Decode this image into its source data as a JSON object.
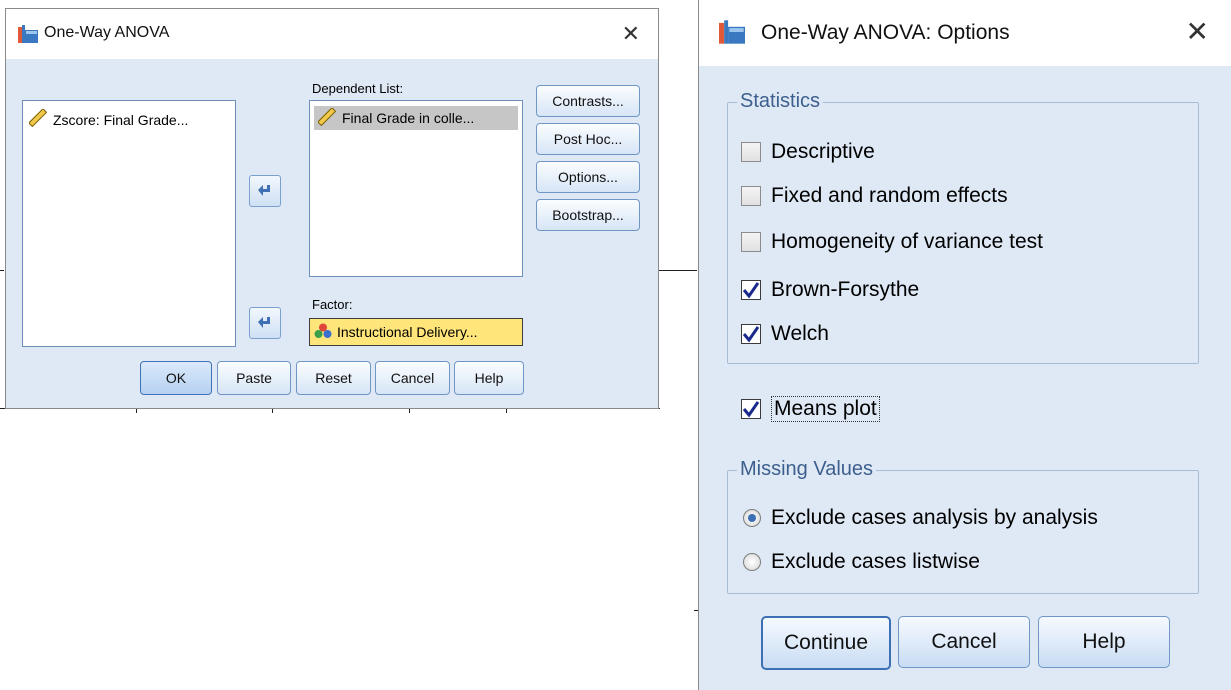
{
  "anova_dialog": {
    "title": "One-Way ANOVA",
    "variables": [
      {
        "label": "Zscore:  Final Grade...",
        "icon": "scale-ruler-icon"
      }
    ],
    "dependent_list_label": "Dependent List:",
    "dependent_items": [
      {
        "label": "Final Grade in colle...",
        "icon": "scale-ruler-icon"
      }
    ],
    "factor_label": "Factor:",
    "factor_value": "Instructional Delivery...",
    "side_buttons": {
      "contrasts": "Contrasts...",
      "post_hoc": "Post Hoc...",
      "options": "Options...",
      "bootstrap": "Bootstrap..."
    },
    "bottom_buttons": {
      "ok": "OK",
      "paste": "Paste",
      "reset": "Reset",
      "cancel": "Cancel",
      "help": "Help"
    }
  },
  "options_dialog": {
    "title": "One-Way ANOVA: Options",
    "statistics_group": "Statistics",
    "statistics": [
      {
        "label": "Descriptive",
        "checked": false
      },
      {
        "label": "Fixed and random effects",
        "checked": false
      },
      {
        "label": "Homogeneity of variance test",
        "checked": false
      },
      {
        "label": "Brown-Forsythe",
        "checked": true
      },
      {
        "label": "Welch",
        "checked": true
      }
    ],
    "means_plot": {
      "label": "Means plot",
      "checked": true
    },
    "missing_group": "Missing Values",
    "missing_options": [
      {
        "label": "Exclude cases analysis by analysis",
        "selected": true
      },
      {
        "label": "Exclude cases listwise",
        "selected": false
      }
    ],
    "buttons": {
      "continue": "Continue",
      "cancel": "Cancel",
      "help": "Help"
    }
  },
  "colors": {
    "dialog_body": "#dfe9f5",
    "factor_highlight": "#ffe57a",
    "group_title": "#3d5f8e",
    "check_mark": "#1a2a8c"
  }
}
